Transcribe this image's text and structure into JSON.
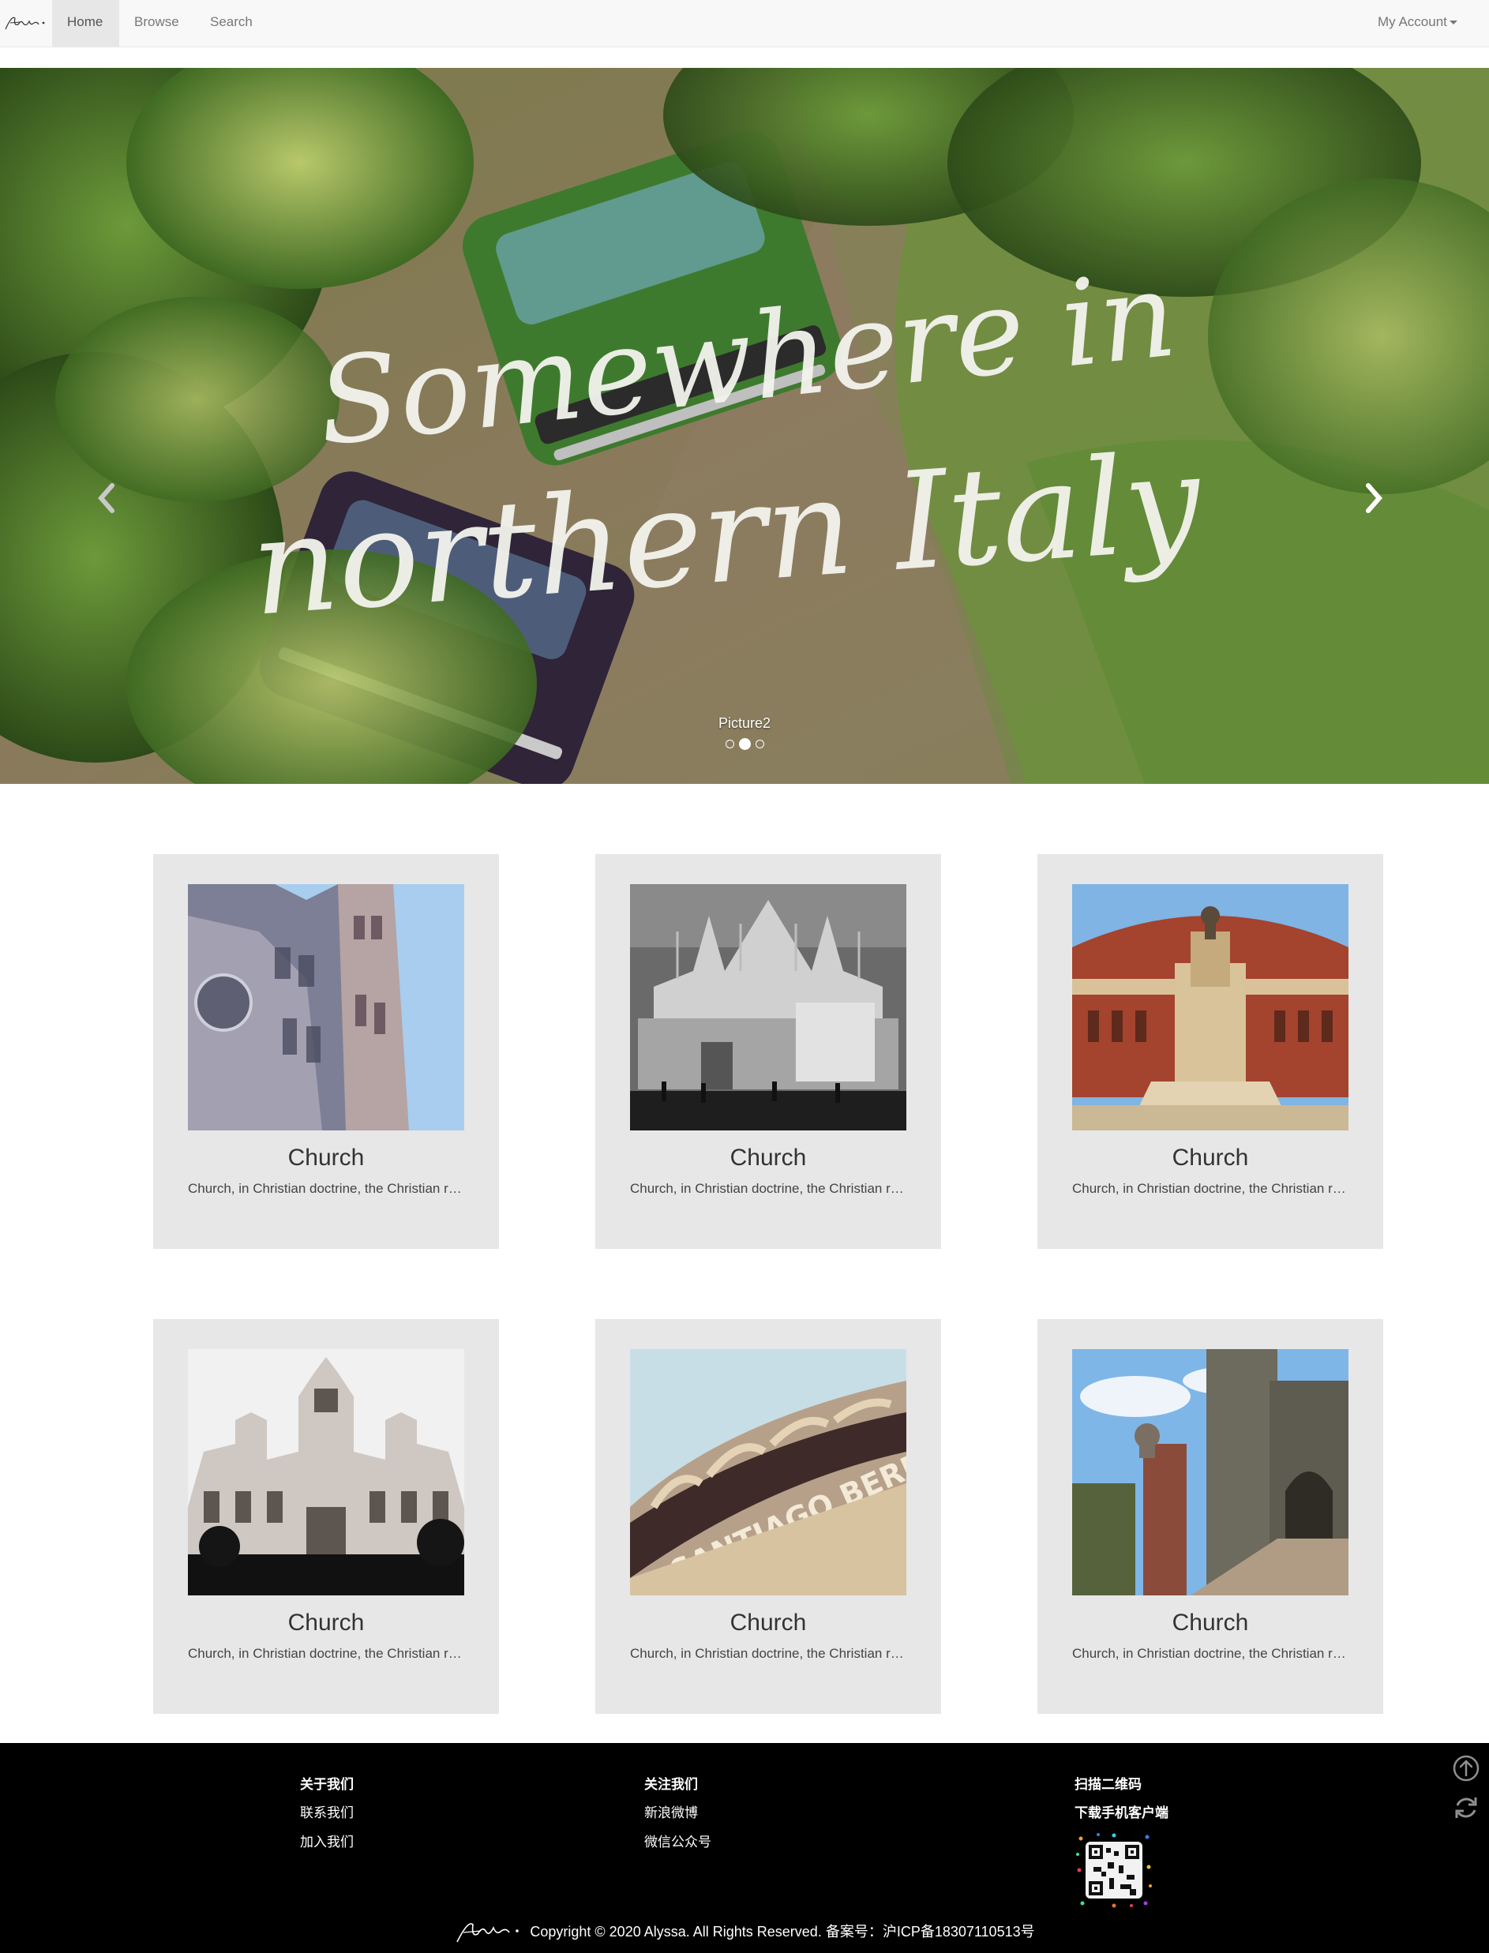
{
  "nav": {
    "brand": "Alyssa's",
    "items": [
      {
        "label": "Home",
        "active": true
      },
      {
        "label": "Browse",
        "active": false
      },
      {
        "label": "Search",
        "active": false
      }
    ],
    "account_label": "My Account"
  },
  "carousel": {
    "headline_line1": "Somewhere in",
    "headline_line2": "northern Italy",
    "caption": "Picture2",
    "slide_count": 3,
    "active_index": 1
  },
  "cards": [
    {
      "title": "Church",
      "desc": "Church, in Christian doctrine, the Christian religious community"
    },
    {
      "title": "Church",
      "desc": "Church, in Christian doctrine, the Christian religious community"
    },
    {
      "title": "Church",
      "desc": "Church, in Christian doctrine, the Christian religious community"
    },
    {
      "title": "Church",
      "desc": "Church, in Christian doctrine, the Christian religious community"
    },
    {
      "title": "Church",
      "desc": "Church, in Christian doctrine, the Christian religious community"
    },
    {
      "title": "Church",
      "desc": "Church, in Christian doctrine, the Christian religious community"
    }
  ],
  "footer": {
    "col1": {
      "heading": "关于我们",
      "links": [
        "联系我们",
        "加入我们"
      ]
    },
    "col2": {
      "heading": "关注我们",
      "links": [
        "新浪微博",
        "微信公众号"
      ]
    },
    "col3": {
      "heading": "扫描二维码",
      "subheading": "下载手机客户端"
    },
    "copyright": "Copyright © 2020 Alyssa. All Rights Reserved. 备案号：沪ICP备18307110513号"
  },
  "colors": {
    "navbar_bg": "#f8f8f8",
    "card_bg": "#e7e7e7",
    "footer_bg": "#000000"
  }
}
